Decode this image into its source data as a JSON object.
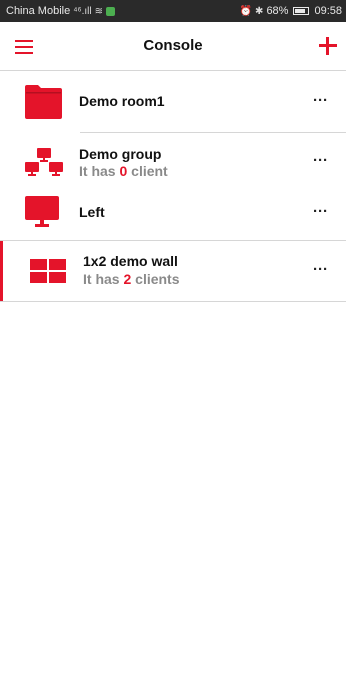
{
  "status_bar": {
    "carrier": "China Mobile",
    "signal": "⁴⁶.ıll",
    "battery": "68%",
    "time": "09:58"
  },
  "header": {
    "title": "Console",
    "menu_icon": "hamburger-menu-icon",
    "add_icon": "plus-icon"
  },
  "colors": {
    "accent": "#e4142a",
    "muted": "#8a8a8a"
  },
  "items": [
    {
      "name": "Demo room1",
      "icon": "folder-icon"
    },
    {
      "name": "Demo group",
      "prefix": "It has ",
      "count": "0",
      "suffix": " client",
      "icon": "monitor-group-icon"
    },
    {
      "name": "Left",
      "icon": "monitor-icon"
    },
    {
      "name": "1x2 demo wall",
      "prefix": "It has ",
      "count": "2",
      "suffix": " clients",
      "icon": "video-wall-icon",
      "selected": true
    }
  ],
  "more_label": "···"
}
